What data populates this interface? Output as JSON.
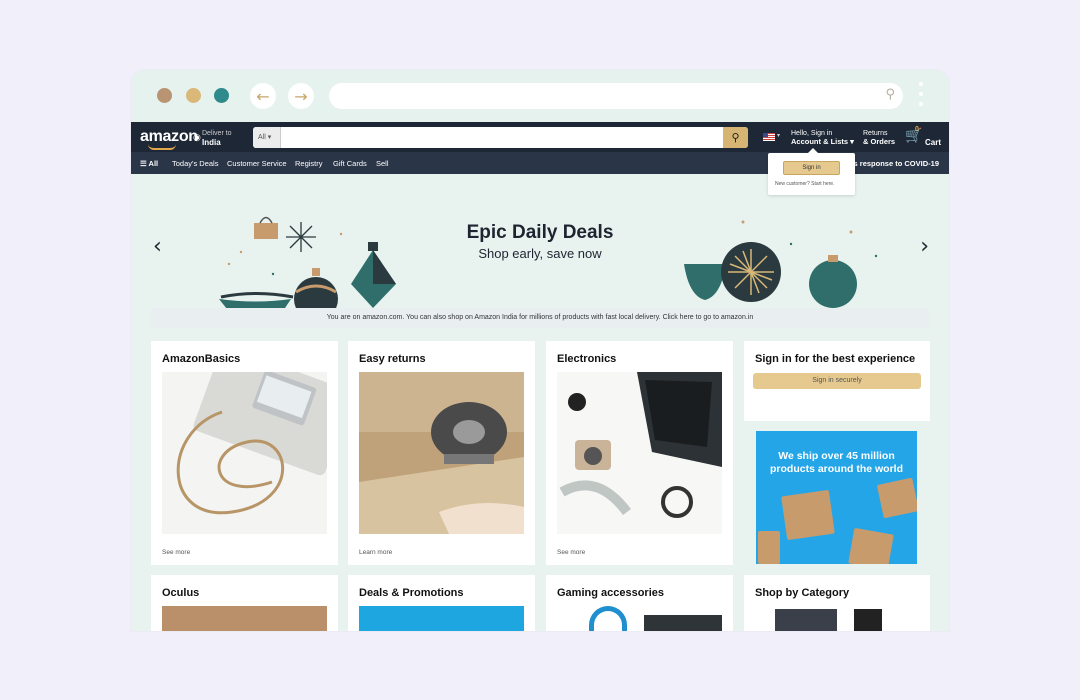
{
  "browser": {
    "dots": [
      "#b89473",
      "#d9b879",
      "#2f8a8c"
    ],
    "back_icon": "arrow-left-icon",
    "forward_icon": "arrow-right-icon",
    "url": ""
  },
  "header": {
    "logo": "amazon",
    "deliver_label": "Deliver to",
    "deliver_location": "India",
    "search_category": "All",
    "search_placeholder": "",
    "account_greeting": "Hello, Sign in",
    "account_label": "Account & Lists",
    "returns_line1": "Returns",
    "returns_line2": "& Orders",
    "cart_count": "0",
    "cart_label": "Cart"
  },
  "subnav": {
    "all": "All",
    "items": [
      "Today's Deals",
      "Customer Service",
      "Registry",
      "Gift Cards",
      "Sell"
    ],
    "promo": "Amazon's response to COVID-19"
  },
  "signin_popover": {
    "button": "Sign in",
    "new_customer": "New customer? Start here."
  },
  "hero": {
    "title": "Epic Daily Deals",
    "subtitle": "Shop early, save now"
  },
  "notice": "You are on amazon.com. You can also shop on Amazon India for millions of products with fast local delivery. Click here to go to amazon.in",
  "cards": [
    {
      "title": "AmazonBasics",
      "link": "See more"
    },
    {
      "title": "Easy returns",
      "link": "Learn more"
    },
    {
      "title": "Electronics",
      "link": "See more"
    },
    {
      "title": "Sign in for the best experience",
      "button": "Sign in securely"
    },
    {
      "title": "Oculus"
    },
    {
      "title": "Deals & Promotions"
    },
    {
      "title": "Gaming accessories"
    },
    {
      "title": "Shop by Category"
    }
  ],
  "ship_promo": "We ship over 45 million products around the world",
  "colors": {
    "accent": "#d6b473",
    "nav_dark": "#1d2736",
    "nav_sub": "#2a3547",
    "page_bg": "#e8f3ef",
    "promo_blue": "#23a5e8"
  }
}
